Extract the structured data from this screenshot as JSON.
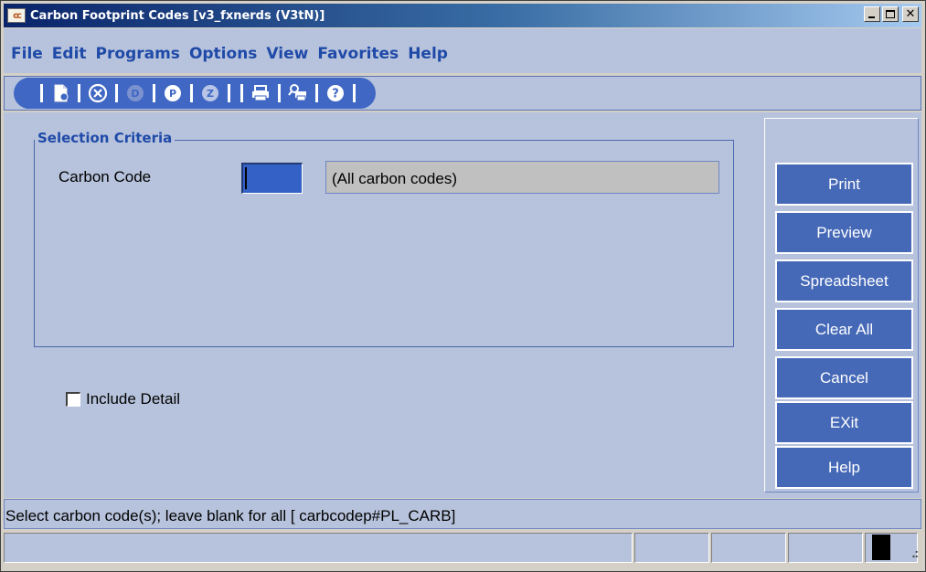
{
  "window": {
    "title": "Carbon Footprint Codes [v3_fxnerds (V3tN)]",
    "app_icon_text": "cc"
  },
  "menu": [
    "File",
    "Edit",
    "Programs",
    "Options",
    "View",
    "Favorites",
    "Help"
  ],
  "toolbar": {
    "icons": [
      "new-document-icon",
      "cancel-icon",
      "delete-icon",
      "process-icon",
      "zoom-icon",
      "print-icon",
      "preview-icon",
      "help-icon"
    ]
  },
  "selection": {
    "legend": "Selection Criteria",
    "carbon_code_label": "Carbon Code",
    "carbon_code_value": "",
    "description": "(All carbon codes)"
  },
  "include_detail": {
    "label": "Include Detail",
    "checked": false
  },
  "buttons": {
    "print": "Print",
    "preview": "Preview",
    "spreadsheet": "Spreadsheet",
    "clear_all": "Clear All",
    "cancel": "Cancel",
    "exit": "EXit",
    "help": "Help"
  },
  "status": {
    "message": "Select carbon code(s); leave blank for all [ carbcodep#PL_CARB]"
  },
  "colors": {
    "menu_text": "#1f4aa8",
    "panel_bg": "#b7c3dc",
    "button_bg": "#4669b7",
    "toolbar_bg": "#3f67c3"
  }
}
